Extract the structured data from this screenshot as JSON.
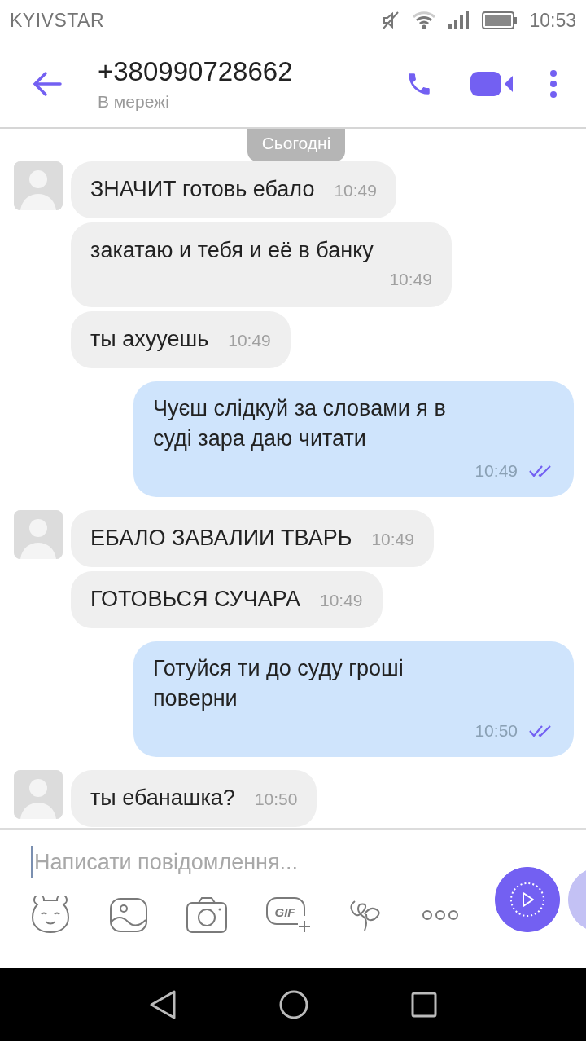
{
  "status_bar": {
    "carrier": "KYIVSTAR",
    "time": "10:53"
  },
  "header": {
    "title": "+380990728662",
    "subtitle": "В мережі"
  },
  "date_separator": "Сьогодні",
  "messages": [
    {
      "kind": "incoming",
      "avatar": true,
      "text": "ЗНАЧИТ готовь ебало",
      "time": "10:49"
    },
    {
      "kind": "incoming",
      "avatar": false,
      "text": "закатаю и тебя и её в банку",
      "time": "10:49"
    },
    {
      "kind": "incoming",
      "avatar": false,
      "text": "ты ахууешь",
      "time": "10:49"
    },
    {
      "kind": "outgoing",
      "text": "Чуєш слідкуй за словами я в суді зара даю читати",
      "time": "10:49",
      "read": true
    },
    {
      "kind": "incoming",
      "avatar": true,
      "text": "ЕБАЛО ЗАВАЛИИ ТВАРЬ",
      "time": "10:49"
    },
    {
      "kind": "incoming",
      "avatar": false,
      "text": "ГОТОВЬСЯ СУЧАРА",
      "time": "10:49"
    },
    {
      "kind": "outgoing",
      "text": "Готуйся ти до суду гроші поверни",
      "time": "10:50",
      "read": true
    },
    {
      "kind": "incoming",
      "avatar": true,
      "text": "ты ебанашка?",
      "time": "10:50"
    }
  ],
  "composer": {
    "placeholder": "Написати повідомлення..."
  },
  "toolbar": [
    {
      "kind": "sticker"
    },
    {
      "kind": "gallery"
    },
    {
      "kind": "camera"
    },
    {
      "kind": "gif",
      "label": "GIF"
    },
    {
      "kind": "doodle"
    },
    {
      "kind": "more"
    }
  ]
}
